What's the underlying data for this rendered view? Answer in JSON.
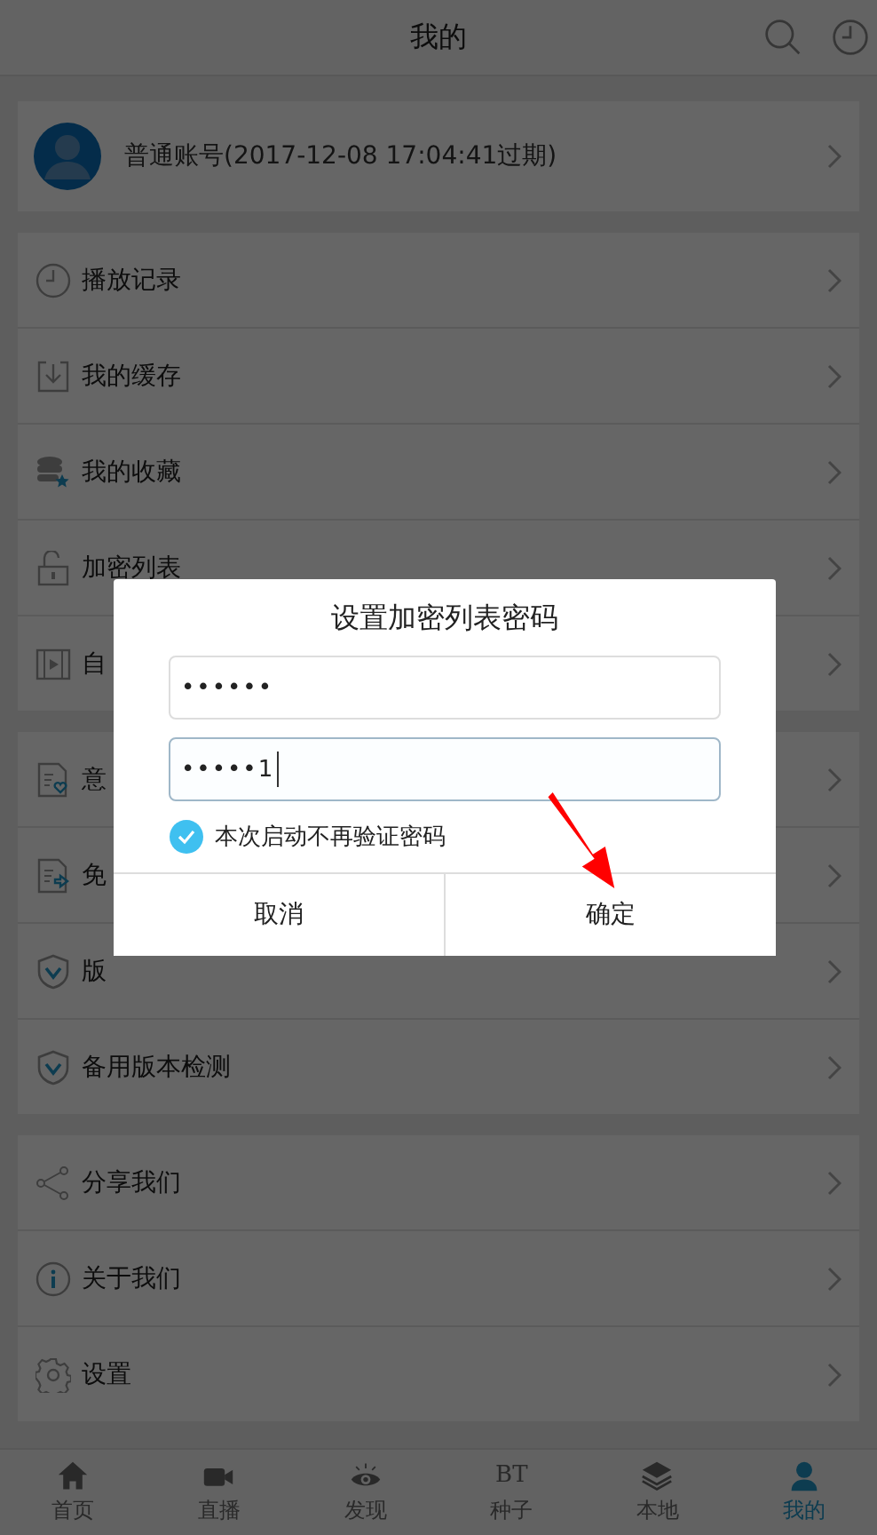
{
  "header": {
    "title": "我的"
  },
  "account": {
    "label": "普通账号(2017-12-08 17:04:41过期)"
  },
  "sections": [
    {
      "items": [
        {
          "label": "播放记录"
        },
        {
          "label": "我的缓存"
        },
        {
          "label": "我的收藏"
        },
        {
          "label": "加密列表"
        },
        {
          "label": "自"
        }
      ]
    },
    {
      "items": [
        {
          "label": "意"
        },
        {
          "label": "免"
        },
        {
          "label": "版"
        },
        {
          "label": "备用版本检测"
        }
      ]
    },
    {
      "items": [
        {
          "label": "分享我们"
        },
        {
          "label": "关于我们"
        },
        {
          "label": "设置"
        }
      ]
    }
  ],
  "dialog": {
    "title": "设置加密列表密码",
    "fields": [
      {
        "value": "••••••",
        "focused": false
      },
      {
        "value": "•••••1",
        "focused": true
      }
    ],
    "checkbox": {
      "label": "本次启动不再验证密码",
      "checked": true
    },
    "buttons": [
      {
        "label": "取消"
      },
      {
        "label": "确定"
      }
    ]
  },
  "nav": [
    {
      "label": "首页",
      "selected": false
    },
    {
      "label": "直播",
      "selected": false
    },
    {
      "label": "发现",
      "selected": false
    },
    {
      "label": "种子",
      "selected": false,
      "glyph": "BT"
    },
    {
      "label": "本地",
      "selected": false
    },
    {
      "label": "我的",
      "selected": true
    }
  ]
}
